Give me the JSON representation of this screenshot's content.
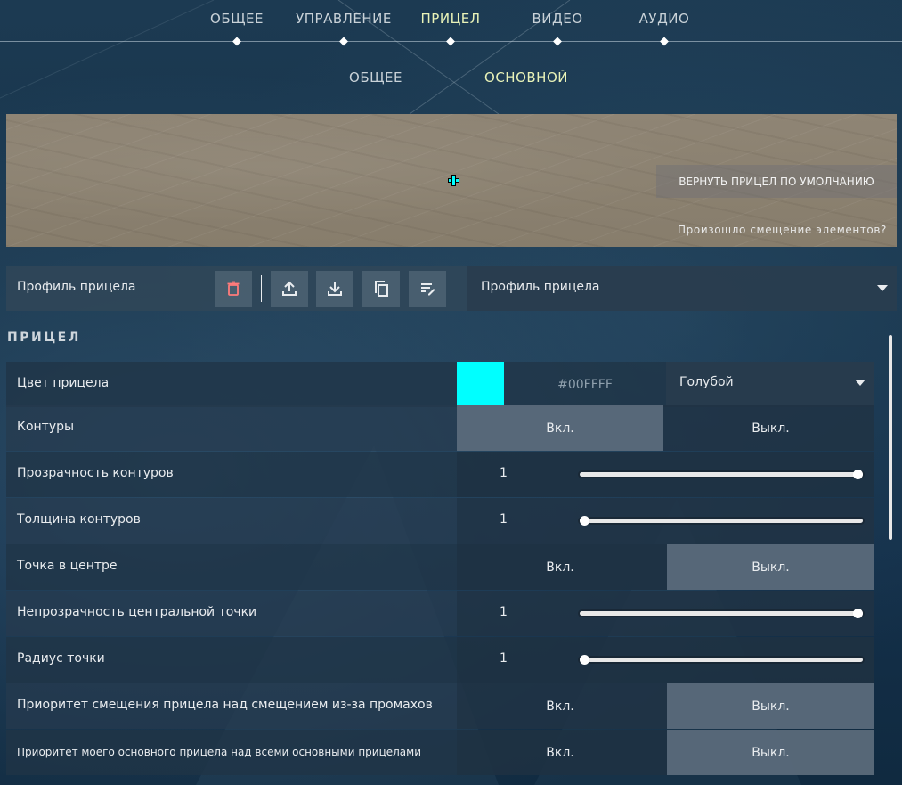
{
  "top_tabs": [
    {
      "label": "ОБЩЕЕ",
      "active": false
    },
    {
      "label": "УПРАВЛЕНИЕ",
      "active": false
    },
    {
      "label": "ПРИЦЕЛ",
      "active": true
    },
    {
      "label": "ВИДЕО",
      "active": false
    },
    {
      "label": "АУДИО",
      "active": false
    }
  ],
  "sub_tabs": [
    {
      "label": "ОБЩЕЕ",
      "active": false
    },
    {
      "label": "ОСНОВНОЙ",
      "active": true
    }
  ],
  "preview": {
    "reset_button": "ВЕРНУТЬ ПРИЦЕЛ ПО УМОЛЧАНИЮ",
    "shift_link": "Произошло смещение элементов?",
    "crosshair_color": "#00FFFF"
  },
  "profile_bar": {
    "label": "Профиль прицела",
    "selected_profile": "Профиль прицела",
    "icons": [
      "delete-icon",
      "upload-icon",
      "download-icon",
      "copy-icon",
      "rename-icon"
    ]
  },
  "section_title": "ПРИЦЕЛ",
  "settings": {
    "crosshair_color": {
      "label": "Цвет прицела",
      "hex": "#00FFFF",
      "color_name": "Голубой",
      "swatch": "#00FFFF"
    },
    "outlines": {
      "label": "Контуры",
      "on": "Вкл.",
      "off": "Выкл.",
      "selected": "on"
    },
    "outline_opacity": {
      "label": "Прозрачность контуров",
      "value": "1",
      "fraction": 1.0
    },
    "outline_thickness": {
      "label": "Толщина контуров",
      "value": "1",
      "fraction": 0.0
    },
    "center_dot": {
      "label": "Точка в центре",
      "on": "Вкл.",
      "off": "Выкл.",
      "selected": "off"
    },
    "center_dot_opacity": {
      "label": "Непрозрачность центральной точки",
      "value": "1",
      "fraction": 1.0
    },
    "center_dot_radius": {
      "label": "Радиус точки",
      "value": "1",
      "fraction": 0.0
    },
    "firing_error_override": {
      "label": "Приоритет смещения прицела над смещением из-за промахов",
      "on": "Вкл.",
      "off": "Выкл.",
      "selected": "off"
    },
    "primary_override": {
      "label": "Приоритет моего основного прицела над всеми основными прицелами",
      "on": "Вкл.",
      "off": "Выкл.",
      "selected": "off"
    }
  }
}
